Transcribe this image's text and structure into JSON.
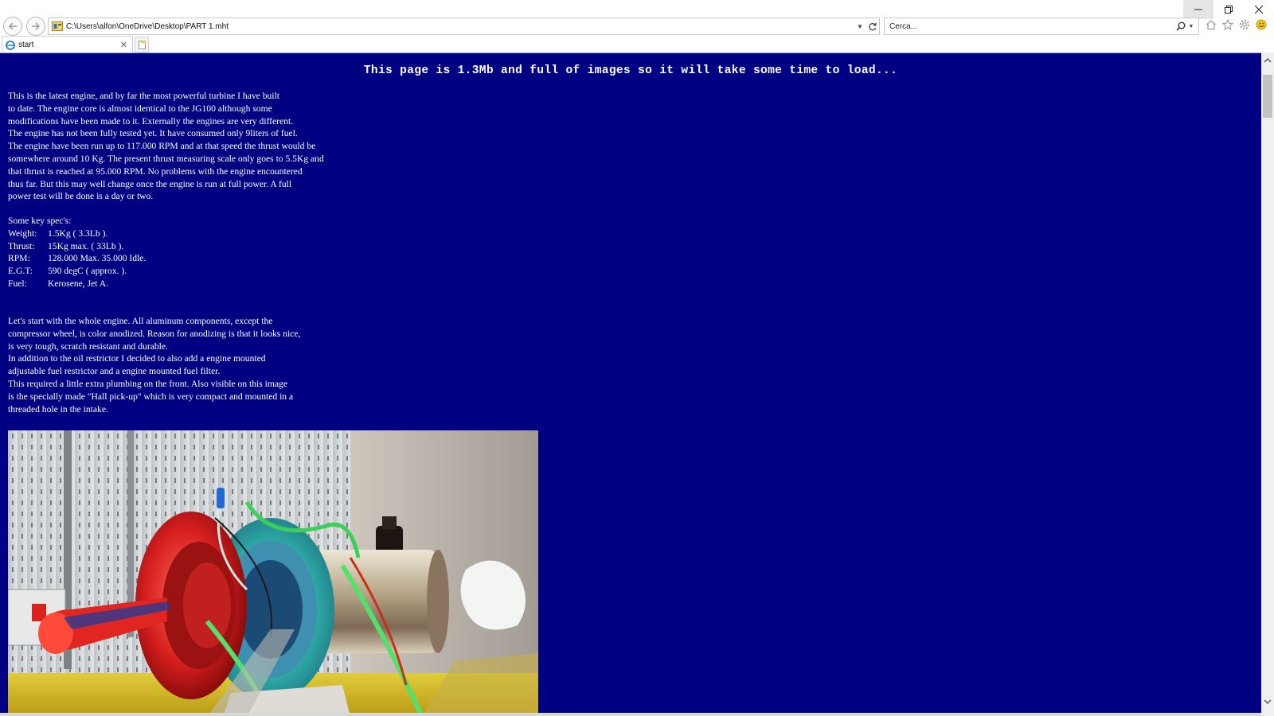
{
  "browser": {
    "address": "C:\\Users\\alfon\\OneDrive\\Desktop\\PART 1.mht",
    "search_placeholder": "Cerca...",
    "tab_title": "start",
    "icons": [
      "back-icon",
      "forward-icon",
      "refresh-icon",
      "search-icon",
      "home-icon",
      "favorites-star-icon",
      "settings-gear-icon",
      "feedback-smiley-icon"
    ]
  },
  "page": {
    "heading": "This page is 1.3Mb and full of images so it will take some time to load...",
    "intro_lines": [
      "This is the latest engine, and by far the most powerful turbine I have built",
      "to date. The engine core is almost identical to the JG100 although some",
      "modifications have been made to it. Externally the engines are very different.",
      "The engine has not been fully tested yet. It have consumed only 9liters of fuel.",
      "The engine have been run up to 117.000 RPM and at that speed the thrust would be",
      "somewhere around 10 Kg. The present thrust measuring scale only goes to 5.5Kg and",
      "that thrust is reached at 95.000 RPM. No problems with the engine encountered",
      "thus far. But this may well change once the engine is run at full power. A full",
      "power test will be done is a day or two."
    ],
    "specs_title": "Some key spec's:",
    "specs": [
      {
        "label": "Weight:",
        "value": "1.5Kg ( 3.3Lb )."
      },
      {
        "label": "Thrust:",
        "value": "15Kg max. ( 33Lb )."
      },
      {
        "label": "RPM:",
        "value": "128.000 Max. 35.000 Idle."
      },
      {
        "label": "E.G.T:",
        "value": "590 degC ( approx. )."
      },
      {
        "label": "Fuel:",
        "value": "Kerosene, Jet A."
      }
    ],
    "body_lines": [
      "Let's start with the whole engine. All aluminum components, except the",
      "compressor wheel, is color anodized. Reason for anodizing is that it looks nice,",
      "is very tough, scratch resistant and durable.",
      "In addition to the oil restrictor I decided to also add a engine mounted",
      "adjustable fuel restrictor and a engine mounted fuel filter.",
      "This required a little extra plumbing on the front. Also visible on this image",
      "is the specially made \"Hall pick-up\" which is very compact and mounted in a",
      "threaded hole in the intake."
    ]
  },
  "colors": {
    "page_background": "#000082",
    "text": "#ffffff"
  }
}
